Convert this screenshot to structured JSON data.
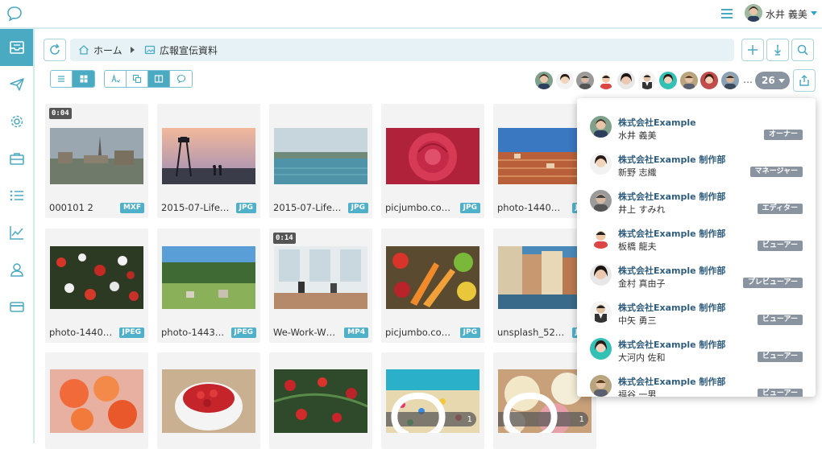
{
  "header": {
    "user_name": "水井 義美",
    "accent_color": "#4aaac2"
  },
  "sidebar": {
    "items": [
      {
        "icon": "inbox-icon",
        "active": true
      },
      {
        "icon": "paper-plane-icon",
        "active": false
      },
      {
        "icon": "gear-icon",
        "active": false
      },
      {
        "icon": "briefcase-icon",
        "active": false
      },
      {
        "icon": "list-icon",
        "active": false
      },
      {
        "icon": "chart-line-icon",
        "active": false
      },
      {
        "icon": "user-icon",
        "active": false
      },
      {
        "icon": "credit-card-icon",
        "active": false
      }
    ]
  },
  "breadcrumb": {
    "home": "ホーム",
    "folder": "広報宣伝資料"
  },
  "members": {
    "more": "…",
    "count": "26"
  },
  "files": [
    {
      "name": "000101 2",
      "type": "MXF",
      "duration": "0:04"
    },
    {
      "name": "2015-07-Life…",
      "type": "JPG"
    },
    {
      "name": "2015-07-Life…",
      "type": "JPG"
    },
    {
      "name": "picjumbo.co…",
      "type": "JPG"
    },
    {
      "name": "photo-1440…",
      "type": "JPG"
    },
    {
      "name": "photo-1440…",
      "type": "JPEG"
    },
    {
      "name": "photo-1443…",
      "type": "JPEG"
    },
    {
      "name": "We-Work-W…",
      "type": "MP4",
      "duration": "0:14"
    },
    {
      "name": "picjumbo.co…",
      "type": "JPG"
    },
    {
      "name": "unsplash_52…",
      "type": "JPG"
    },
    {
      "name": ""
    },
    {
      "name": ""
    },
    {
      "name": ""
    },
    {
      "name": "",
      "comments": "1"
    },
    {
      "name": "",
      "comments": "1"
    }
  ],
  "member_list": [
    {
      "company": "株式会社Example",
      "name": "水井 義美",
      "role": "オーナー"
    },
    {
      "company": "株式会社Example 制作部",
      "name": "新野 志織",
      "role": "マネージャー"
    },
    {
      "company": "株式会社Example 制作部",
      "name": "井上 すみれ",
      "role": "エディター"
    },
    {
      "company": "株式会社Example 制作部",
      "name": "板橋 龍夫",
      "role": "ビューアー"
    },
    {
      "company": "株式会社Example 制作部",
      "name": "金村 真由子",
      "role": "プレビューアー"
    },
    {
      "company": "株式会社Example 制作部",
      "name": "中矢 勇三",
      "role": "ビューアー"
    },
    {
      "company": "株式会社Example 制作部",
      "name": "大河内 佐和",
      "role": "ビューアー"
    },
    {
      "company": "株式会社Example 制作部",
      "name": "福谷 一男",
      "role": "ビューアー"
    }
  ]
}
